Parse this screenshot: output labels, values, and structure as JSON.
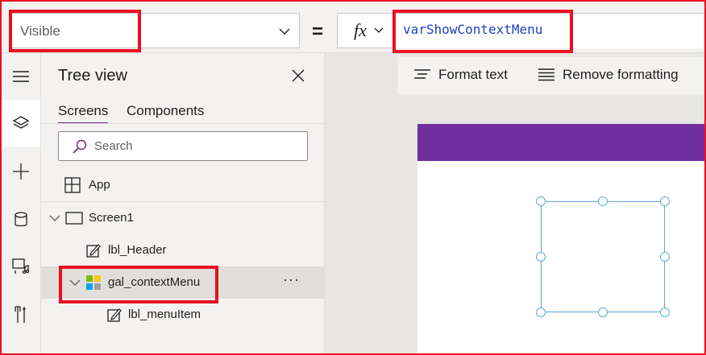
{
  "formula_bar": {
    "property": "Visible",
    "equals": "=",
    "fx_label": "fx",
    "formula": "varShowContextMenu"
  },
  "rail": {
    "items": [
      "hamburger-icon",
      "layers-icon",
      "add-icon",
      "database-icon",
      "media-icon",
      "tools-icon"
    ],
    "active_index": 1
  },
  "tree_view": {
    "title": "Tree view",
    "tabs": [
      {
        "label": "Screens",
        "active": true
      },
      {
        "label": "Components",
        "active": false
      }
    ],
    "search_placeholder": "Search",
    "nodes": [
      {
        "label": "App",
        "icon": "app-icon"
      },
      {
        "label": "Screen1",
        "icon": "screen-icon",
        "expanded": true
      },
      {
        "label": "lbl_Header",
        "icon": "label-edit-icon"
      },
      {
        "label": "gal_contextMenu",
        "icon": "gallery-icon",
        "expanded": true,
        "selected": true,
        "more": "···"
      },
      {
        "label": "lbl_menuItem",
        "icon": "label-edit-icon"
      }
    ]
  },
  "toolbar": {
    "format_text": "Format text",
    "remove_formatting": "Remove formatting"
  },
  "colors": {
    "accent": "#742774",
    "screen_header": "#7030a0",
    "highlight": "#e81123",
    "selection": "#5aa8d8",
    "formula_text": "#1f3fbf"
  }
}
